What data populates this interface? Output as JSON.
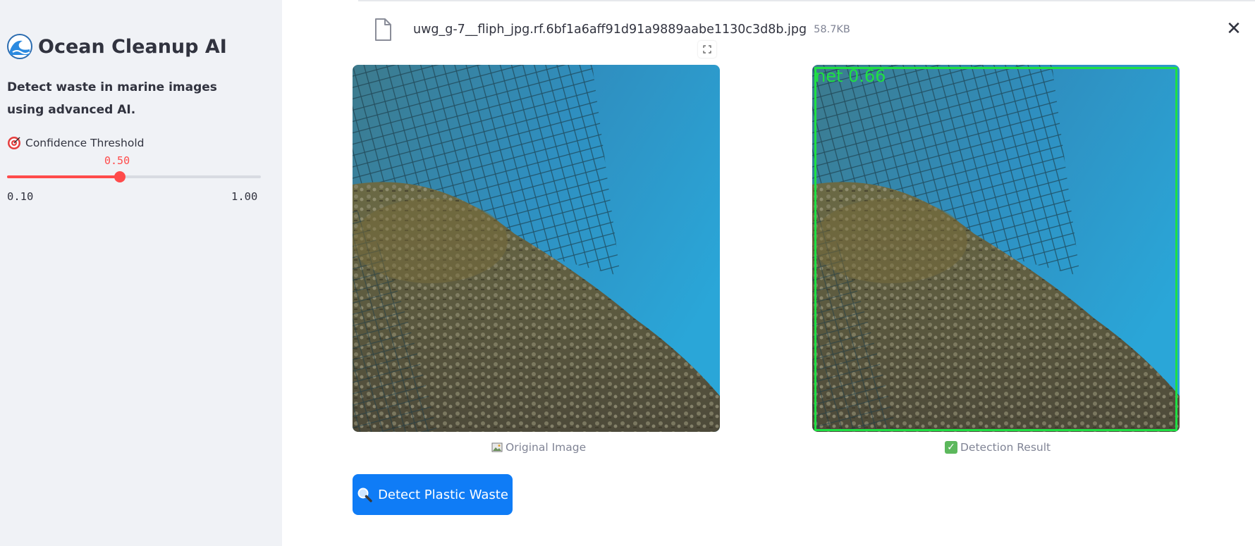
{
  "sidebar": {
    "title": "Ocean Cleanup AI",
    "description": "Detect waste in marine images using advanced AI.",
    "slider": {
      "label": "Confidence Threshold",
      "value": "0.50",
      "value_num": 0.5,
      "min": "0.10",
      "max": "1.00",
      "min_num": 0.1,
      "max_num": 1.0,
      "accent_color": "#ff4b4b"
    },
    "icons": {
      "title": "wave-icon",
      "slider": "target-icon"
    }
  },
  "file": {
    "name": "uwg_g-7__fliph_jpg.rf.6bf1a6aff91d91a9889aabe1130c3d8b.jpg",
    "size": "58.7KB"
  },
  "images": {
    "original_caption": "Original Image",
    "result_caption": "Detection Result",
    "detection_label": "net 0.66",
    "detection_color": "#1ee043"
  },
  "actions": {
    "detect_label": "Detect Plastic Waste",
    "detect_color": "#0f7cf6"
  }
}
